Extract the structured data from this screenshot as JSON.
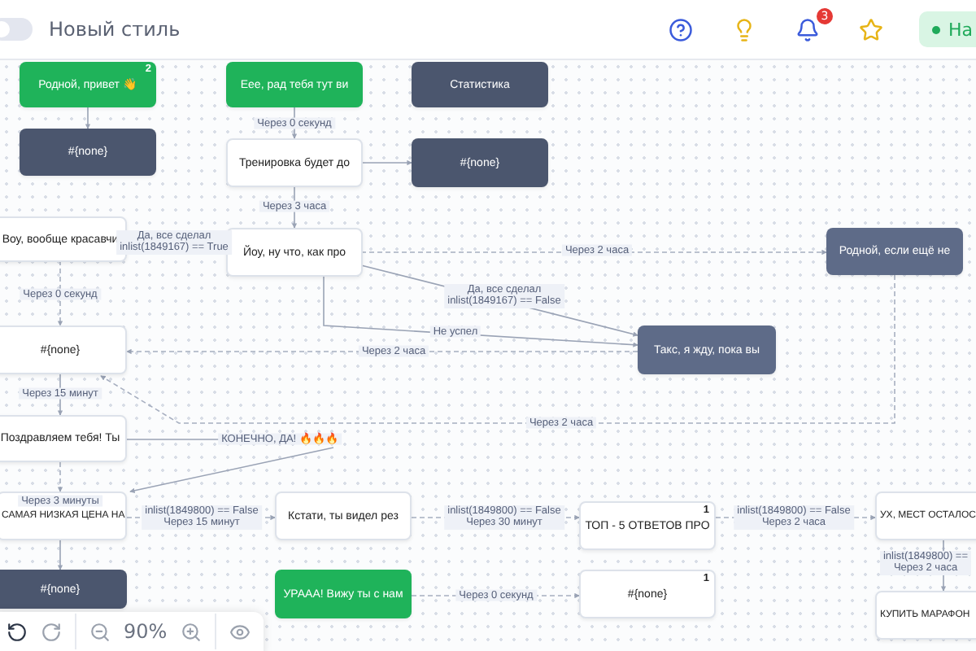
{
  "header": {
    "toggle": {
      "label": "Новый стиль",
      "on": false
    },
    "notifications": {
      "count": "3"
    },
    "status": {
      "label": "На"
    }
  },
  "nodes": [
    {
      "kind": "green",
      "text": "Родной, привет 👋",
      "badge": "2"
    },
    {
      "kind": "dark",
      "text": "#{none}"
    },
    {
      "kind": "green",
      "text": "Еее, рад тебя тут ви"
    },
    {
      "kind": "dark",
      "text": "Статистика"
    },
    {
      "kind": "white",
      "text": "Тренировка будет до"
    },
    {
      "kind": "dark",
      "text": "#{none}"
    },
    {
      "kind": "white",
      "text": "Воу, вообще красавчи"
    },
    {
      "kind": "white",
      "text": "Йоу, ну что, как про"
    },
    {
      "kind": "slate",
      "text": "Родной, если ещё не"
    },
    {
      "kind": "white",
      "text": "#{none}"
    },
    {
      "kind": "slate",
      "text": "Такс, я жду, пока вы"
    },
    {
      "kind": "white",
      "text": "Поздравляем тебя! Ты"
    },
    {
      "kind": "white",
      "text": "САМАЯ НИЗКАЯ ЦЕНА НА"
    },
    {
      "kind": "white",
      "text": "Кстати, ты видел рез"
    },
    {
      "kind": "white",
      "text": "ТОП - 5 ОТВЕТОВ ПРО",
      "badge": "1"
    },
    {
      "kind": "white",
      "text": "УХ, МЕСТ ОСТАЛОС"
    },
    {
      "kind": "dark",
      "text": "#{none}"
    },
    {
      "kind": "green",
      "text": "УРААА! Вижу ты с нам"
    },
    {
      "kind": "white",
      "text": "#{none}",
      "badge": "1"
    },
    {
      "kind": "white",
      "text": "КУПИТЬ МАРАФОН"
    }
  ],
  "edge_labels": [
    {
      "lines": [
        "Через 0 секунд"
      ]
    },
    {
      "lines": [
        "Через 3 часа"
      ]
    },
    {
      "lines": [
        "Да, все сделал",
        "inlist(1849167) == True"
      ]
    },
    {
      "lines": [
        "Через 2 часа"
      ]
    },
    {
      "lines": [
        "Да, все сделал",
        "inlist(1849167) == False"
      ]
    },
    {
      "lines": [
        "Не успел"
      ]
    },
    {
      "lines": [
        "Через 2 часа"
      ]
    },
    {
      "lines": [
        "Через 0 секунд"
      ]
    },
    {
      "lines": [
        "Через 15 минут"
      ]
    },
    {
      "lines": [
        "Через 2 часа"
      ]
    },
    {
      "lines": [
        "КОНЕЧНО, ДА! 🔥🔥🔥"
      ]
    },
    {
      "lines": [
        "Через 3 минуты"
      ]
    },
    {
      "lines": [
        "inlist(1849800) == False",
        "Через 15 минут"
      ]
    },
    {
      "lines": [
        "inlist(1849800) == False",
        "Через 30 минут"
      ]
    },
    {
      "lines": [
        "inlist(1849800) == False",
        "Через 2 часа"
      ]
    },
    {
      "lines": [
        "inlist(1849800) ==",
        "Через 2 часа"
      ]
    },
    {
      "lines": [
        "Через 0 секунд"
      ]
    }
  ],
  "toolbar": {
    "zoom": "90%"
  }
}
